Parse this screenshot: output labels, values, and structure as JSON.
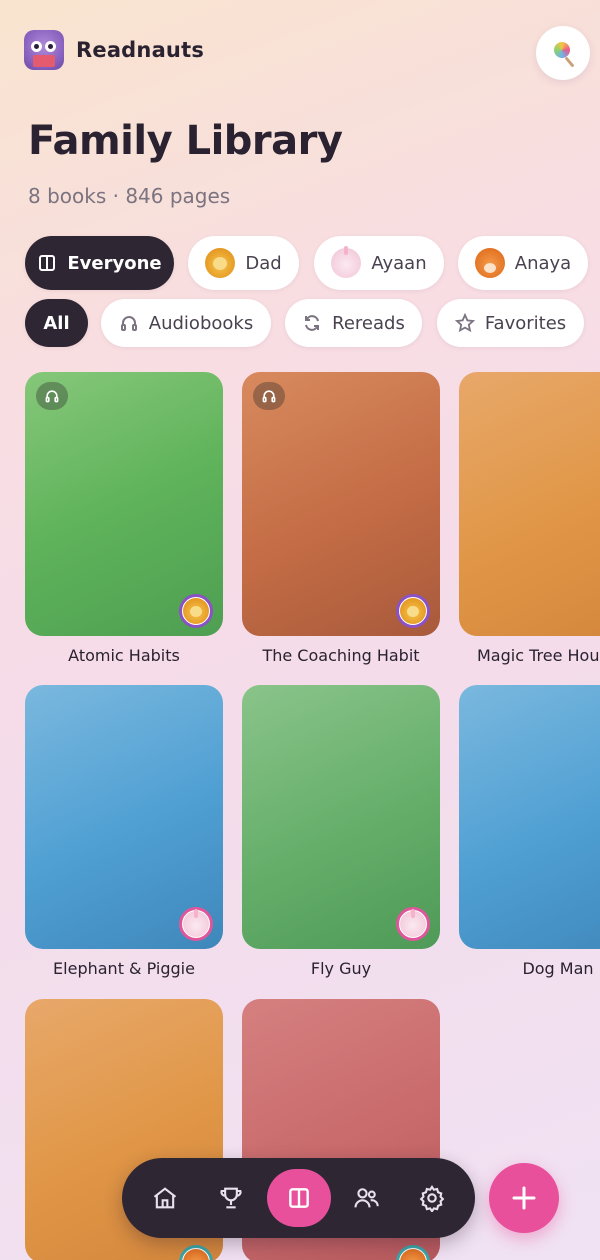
{
  "app": {
    "name": "Readnauts",
    "logo_icon": "owl-reading-icon"
  },
  "header": {
    "search_icon": "lollipop-icon"
  },
  "library": {
    "title": "Family Library",
    "subtitle": "8 books · 846 pages"
  },
  "member_filters": [
    {
      "label": "Everyone",
      "icon": "columns-icon",
      "active": true
    },
    {
      "label": "Dad",
      "icon": "lion-avatar",
      "active": false
    },
    {
      "label": "Ayaan",
      "icon": "unicorn-avatar",
      "active": false
    },
    {
      "label": "Anaya",
      "icon": "fox-avatar",
      "active": false
    }
  ],
  "type_filters": [
    {
      "label": "All",
      "icon": "",
      "active": true
    },
    {
      "label": "Audiobooks",
      "icon": "headphones-icon",
      "active": false
    },
    {
      "label": "Rereads",
      "icon": "refresh-icon",
      "active": false
    },
    {
      "label": "Favorites",
      "icon": "star-icon",
      "active": false
    }
  ],
  "books": [
    {
      "title": "Atomic Habits",
      "color": "green",
      "audiobook": true,
      "owner": "lion"
    },
    {
      "title": "The Coaching Habit",
      "color": "rust",
      "audiobook": true,
      "owner": "lion"
    },
    {
      "title": "Magic Tree House",
      "color": "orange",
      "audiobook": false,
      "owner": ""
    },
    {
      "title": "Elephant & Piggie",
      "color": "blue",
      "audiobook": false,
      "owner": "unicorn"
    },
    {
      "title": "Fly Guy",
      "color": "green",
      "audiobook": false,
      "owner": "unicorn"
    },
    {
      "title": "Dog Man",
      "color": "blue",
      "audiobook": false,
      "owner": ""
    },
    {
      "title": "",
      "color": "orange",
      "audiobook": false,
      "owner": "fox"
    },
    {
      "title": "",
      "color": "rose",
      "audiobook": false,
      "owner": "fox"
    }
  ],
  "bottom_nav": [
    {
      "name": "home",
      "icon": "home-icon",
      "active": false
    },
    {
      "name": "achievements",
      "icon": "trophy-icon",
      "active": false
    },
    {
      "name": "library",
      "icon": "book-open-icon",
      "active": true
    },
    {
      "name": "family",
      "icon": "people-icon",
      "active": false
    },
    {
      "name": "settings",
      "icon": "gear-icon",
      "active": false
    }
  ],
  "fab": {
    "icon": "plus-icon"
  },
  "colors": {
    "accent": "#e8509c",
    "dark": "#2e2633",
    "owner_ring_dad": "#8a52c4",
    "owner_ring_ayaan": "#e0569a",
    "owner_ring_anaya": "#3aa7a8"
  }
}
